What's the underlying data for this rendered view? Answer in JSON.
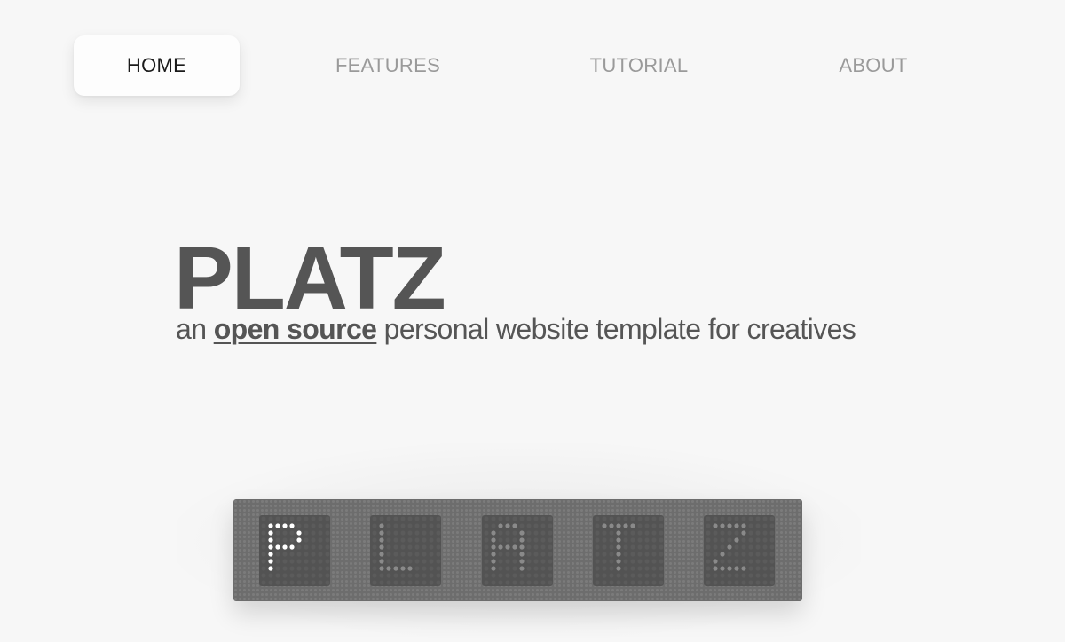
{
  "nav": {
    "items": [
      {
        "label": "HOME",
        "active": true
      },
      {
        "label": "FEATURES",
        "active": false
      },
      {
        "label": "TUTORIAL",
        "active": false
      },
      {
        "label": "ABOUT",
        "active": false
      }
    ]
  },
  "hero": {
    "title": "PLATZ",
    "subtitle_prefix": "an ",
    "subtitle_link": "open source",
    "subtitle_suffix": " personal website template for creatives"
  },
  "display": {
    "letters": [
      "P",
      "L",
      "A",
      "T",
      "Z"
    ],
    "lit_index": 0,
    "colors": {
      "panel": "#6d6d6d",
      "cell": "#535353",
      "dot_off": "#5b5b5b",
      "dot_lit": "#ffffff",
      "dot_dim": "#8a8a8a"
    }
  }
}
